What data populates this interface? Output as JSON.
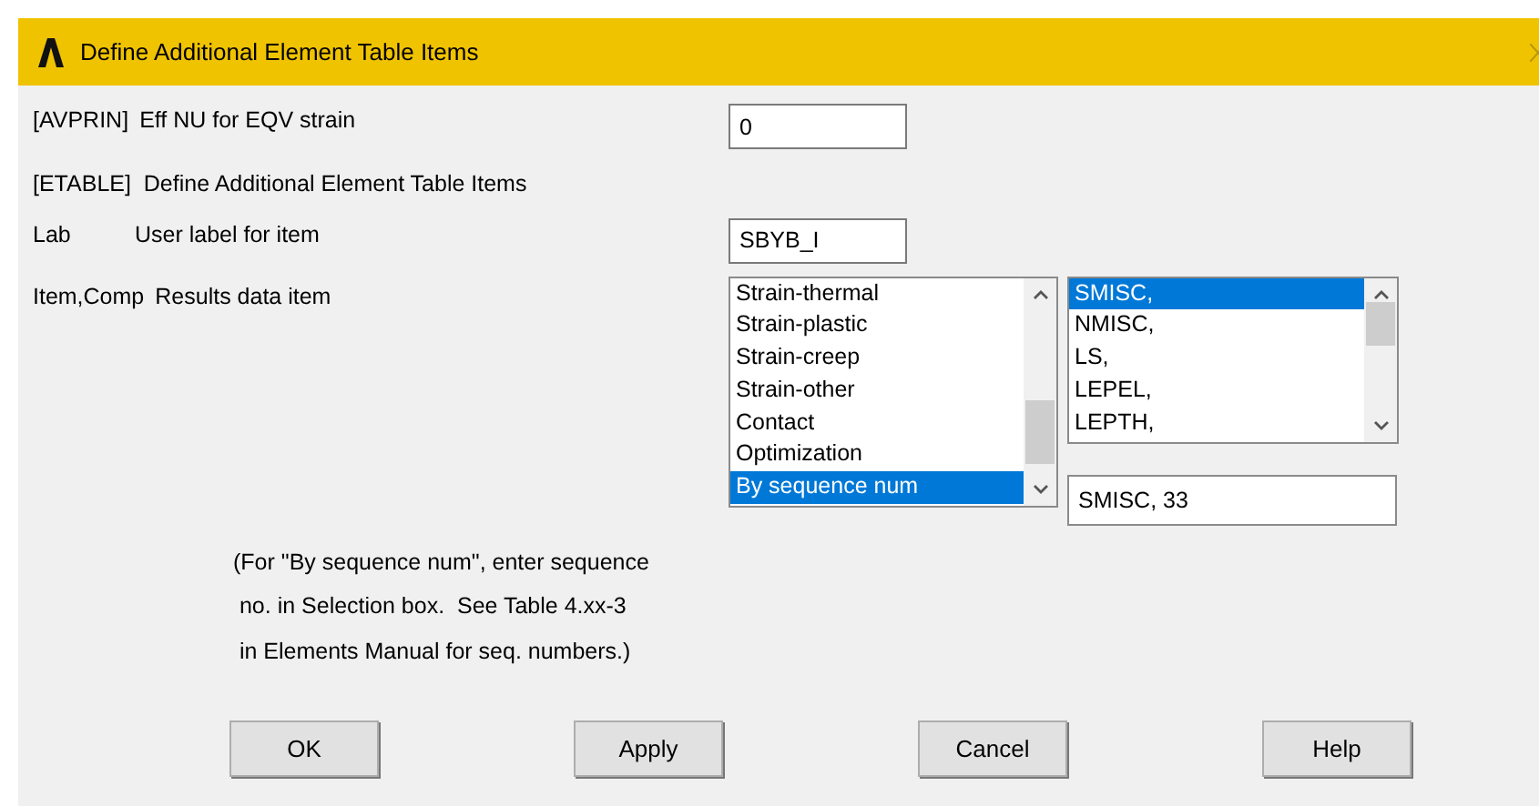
{
  "window": {
    "title": "Define Additional Element Table Items"
  },
  "rows": [
    {
      "kind": "input",
      "label": "[AVPRIN]",
      "description": "Eff NU for EQV strain",
      "value": "0"
    },
    {
      "kind": "heading",
      "text": "[ETABLE]  Define Additional Element Table Items"
    },
    {
      "kind": "input",
      "label": "Lab",
      "description": "User label for item",
      "value": "SBYB_I"
    },
    {
      "kind": "lists",
      "label": "Item,Comp",
      "description": "Results data item",
      "item_list": [
        {
          "text": "Strain-thermal",
          "selected": false
        },
        {
          "text": "Strain-plastic",
          "selected": false
        },
        {
          "text": "Strain-creep",
          "selected": false
        },
        {
          "text": "Strain-other",
          "selected": false
        },
        {
          "text": "Contact",
          "selected": false
        },
        {
          "text": "Optimization",
          "selected": false
        },
        {
          "text": "By sequence num",
          "selected": true
        }
      ],
      "comp_list": [
        {
          "text": "SMISC,",
          "selected": true
        },
        {
          "text": "NMISC,",
          "selected": false
        },
        {
          "text": "LS,",
          "selected": false
        },
        {
          "text": "LEPEL,",
          "selected": false
        },
        {
          "text": "LEPTH,",
          "selected": false
        }
      ],
      "selection": "SMISC, 33"
    }
  ],
  "note": "(For \"By sequence num\", enter sequence\n no. in Selection box.  See Table 4.xx-3\n in Elements Manual for seq. numbers.)",
  "buttons": [
    "OK",
    "Apply",
    "Cancel",
    "Help"
  ]
}
